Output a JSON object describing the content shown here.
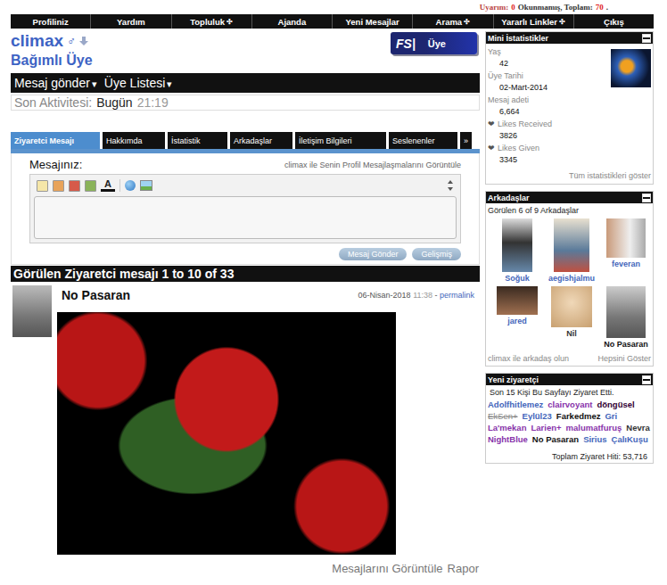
{
  "topbar": {
    "warning_label": "Uyarım:",
    "unread": "0",
    "unread_label": "Okunmamış, Toplam:",
    "total": "70",
    "end": "."
  },
  "nav": [
    {
      "label": "Profiliniz",
      "icon": ""
    },
    {
      "label": "Yardım",
      "icon": ""
    },
    {
      "label": "Topluluk",
      "icon": "✣"
    },
    {
      "label": "Ajanda",
      "icon": ""
    },
    {
      "label": "Yeni Mesajlar",
      "icon": ""
    },
    {
      "label": "Arama",
      "icon": "✣"
    },
    {
      "label": "Yararlı Linkler",
      "icon": "✣"
    },
    {
      "label": "Çıkış",
      "icon": ""
    }
  ],
  "profile": {
    "username": "climax",
    "gender_icon": "♂",
    "title": "Bağımlı Üye",
    "badge": {
      "logo": "FS|",
      "label": "Üye"
    }
  },
  "actions": [
    {
      "label": "Mesaj gönder",
      "arrow": "▾"
    },
    {
      "label": "Üye Listesi",
      "arrow": "▾"
    }
  ],
  "last_activity": {
    "label": "Son Aktivitesi:",
    "day": "Bugün",
    "time": "21:19"
  },
  "tabs": [
    {
      "label": "Ziyaretci Mesajı",
      "selected": true
    },
    {
      "label": "Hakkımda",
      "selected": false
    },
    {
      "label": "İstatistik",
      "selected": false
    },
    {
      "label": "Arkadaşlar",
      "selected": false
    },
    {
      "label": "İletişim Bilgileri",
      "selected": false
    },
    {
      "label": "Seslenenler",
      "selected": false
    },
    {
      "label": "»",
      "selected": false
    }
  ],
  "composer": {
    "label": "Mesajınız:",
    "link": "climax ile Senin Profil Mesajlaşmalarını Görüntüle",
    "color_icon": "A",
    "text": "",
    "buttons": [
      "Mesaj Gönder",
      "Gelişmiş"
    ]
  },
  "messages_header": "Görülen Ziyaretci mesajı 1 to 10 of 33",
  "messages": [
    {
      "author": "No Pasaran",
      "date": "06-Nisan-2018",
      "time": "11:38",
      "separator": "-",
      "permalink": "permalink",
      "links": [
        "Mesajlarını Görüntüle",
        "Rapor"
      ]
    }
  ],
  "mini_stats": {
    "title": "Mini İstatistikler",
    "items": [
      {
        "label": "Yaş",
        "value": "42",
        "icon": ""
      },
      {
        "label": "Üye Tarihi",
        "value": "02-Mart-2014",
        "icon": ""
      },
      {
        "label": "Mesaj adeti",
        "value": "6,664",
        "icon": ""
      },
      {
        "label": "Likes Received",
        "value": "3826",
        "icon": "❤"
      },
      {
        "label": "Likes Given",
        "value": "3345",
        "icon": "❤"
      }
    ],
    "show_all": "Tüm istatistikleri göster"
  },
  "friends": {
    "title": "Arkadaşlar",
    "count_text": "Görülen 6 of 9 Arkadaşlar",
    "items": [
      {
        "name": "Soğuk",
        "color": "#4466bb"
      },
      {
        "name": "aegishjalmu",
        "color": "#4466bb"
      },
      {
        "name": "feveran",
        "color": "#4466bb"
      },
      {
        "name": "jared",
        "color": "#4466bb"
      },
      {
        "name": "Nil",
        "color": "#333333"
      },
      {
        "name": "No Pasaran",
        "color": "#111111"
      }
    ],
    "add": "climax ile arkadaş olun",
    "show_all": "Hepsini Göster"
  },
  "visitors": {
    "title": "Yeni ziyaretçi",
    "summary": "Son 15 Kişi Bu Sayfayı Ziyaret Etti.",
    "items": [
      {
        "name": "Adolfhitlemez",
        "color": "#4466bb",
        "struck": false
      },
      {
        "name": "clairvoyant",
        "color": "#8833aa",
        "struck": false
      },
      {
        "name": "döngüsel",
        "color": "#330033",
        "struck": false
      },
      {
        "name": "EkSen+",
        "color": "#888888",
        "struck": true
      },
      {
        "name": "Eylül23",
        "color": "#4466bb",
        "struck": false
      },
      {
        "name": "Farkedmez",
        "color": "#111111",
        "struck": false
      },
      {
        "name": "Gri",
        "color": "#4466bb",
        "struck": false
      },
      {
        "name": "La'mekan",
        "color": "#8833aa",
        "struck": false
      },
      {
        "name": "Larien+",
        "color": "#8833aa",
        "struck": false
      },
      {
        "name": "malumatfuruş",
        "color": "#8833aa",
        "struck": false
      },
      {
        "name": "Nevra",
        "color": "#333333",
        "struck": false
      },
      {
        "name": "NightBlue",
        "color": "#8833aa",
        "struck": false
      },
      {
        "name": "No Pasaran",
        "color": "#111111",
        "struck": false
      },
      {
        "name": "Sirius",
        "color": "#4466bb",
        "struck": false
      },
      {
        "name": "ÇalıKuşu",
        "color": "#4466bb",
        "struck": false
      }
    ],
    "total": "Toplam Ziyaret Hiti: 53,716"
  }
}
